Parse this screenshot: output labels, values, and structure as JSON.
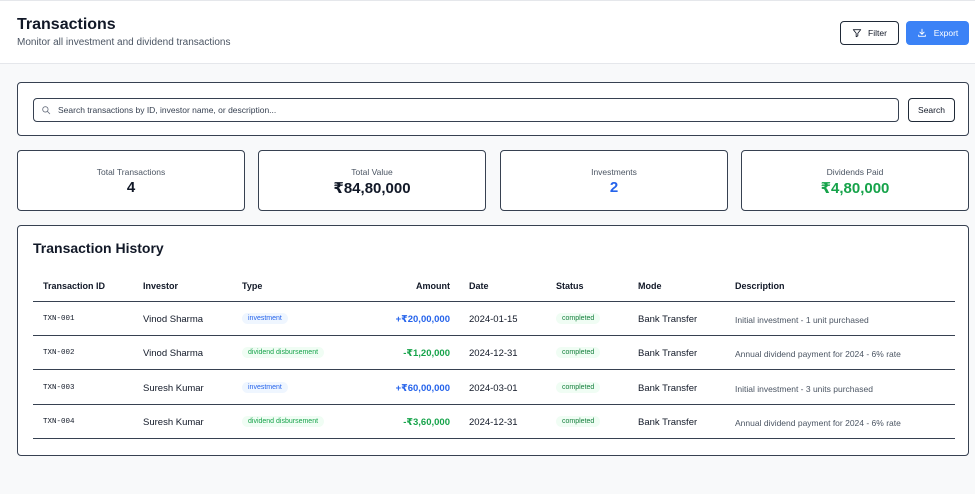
{
  "header": {
    "title": "Transactions",
    "subtitle": "Monitor all investment and dividend transactions",
    "filter_label": "Filter",
    "export_label": "Export"
  },
  "search": {
    "placeholder": "Search transactions by ID, investor name, or description...",
    "value": "",
    "button_label": "Search"
  },
  "stats": [
    {
      "label": "Total Transactions",
      "value": "4",
      "color": "#111827"
    },
    {
      "label": "Total Value",
      "value": "₹84,80,000",
      "color": "#111827"
    },
    {
      "label": "Investments",
      "value": "2",
      "color": "#2563eb"
    },
    {
      "label": "Dividends Paid",
      "value": "₹4,80,000",
      "color": "#16a34a"
    }
  ],
  "history": {
    "title": "Transaction History",
    "columns": [
      "Transaction ID",
      "Investor",
      "Type",
      "Amount",
      "Date",
      "Status",
      "Mode",
      "Description"
    ],
    "rows": [
      {
        "id": "TXN-001",
        "investor": "Vinod Sharma",
        "type": "investment",
        "amount": "+₹20,00,000",
        "date": "2024-01-15",
        "status": "completed",
        "mode": "Bank Transfer",
        "description": "Initial investment - 1 unit purchased"
      },
      {
        "id": "TXN-002",
        "investor": "Vinod Sharma",
        "type": "dividend disbursement",
        "amount": "-₹1,20,000",
        "date": "2024-12-31",
        "status": "completed",
        "mode": "Bank Transfer",
        "description": "Annual dividend payment for 2024 - 6% rate"
      },
      {
        "id": "TXN-003",
        "investor": "Suresh Kumar",
        "type": "investment",
        "amount": "+₹60,00,000",
        "date": "2024-03-01",
        "status": "completed",
        "mode": "Bank Transfer",
        "description": "Initial investment - 3 units purchased"
      },
      {
        "id": "TXN-004",
        "investor": "Suresh Kumar",
        "type": "dividend disbursement",
        "amount": "-₹3,60,000",
        "date": "2024-12-31",
        "status": "completed",
        "mode": "Bank Transfer",
        "description": "Annual dividend payment for 2024 - 6% rate"
      }
    ]
  },
  "colors": {
    "accent": "#3b82f6",
    "investment_text": "#2563eb",
    "investment_bg": "#eff6ff",
    "dividend_text": "#16a34a",
    "dividend_bg": "#f0fdf4",
    "status_text": "#15803d",
    "status_bg": "#f0fdf4"
  },
  "icons": {
    "filter": "filter-icon",
    "export": "download-icon",
    "search": "search-icon"
  }
}
